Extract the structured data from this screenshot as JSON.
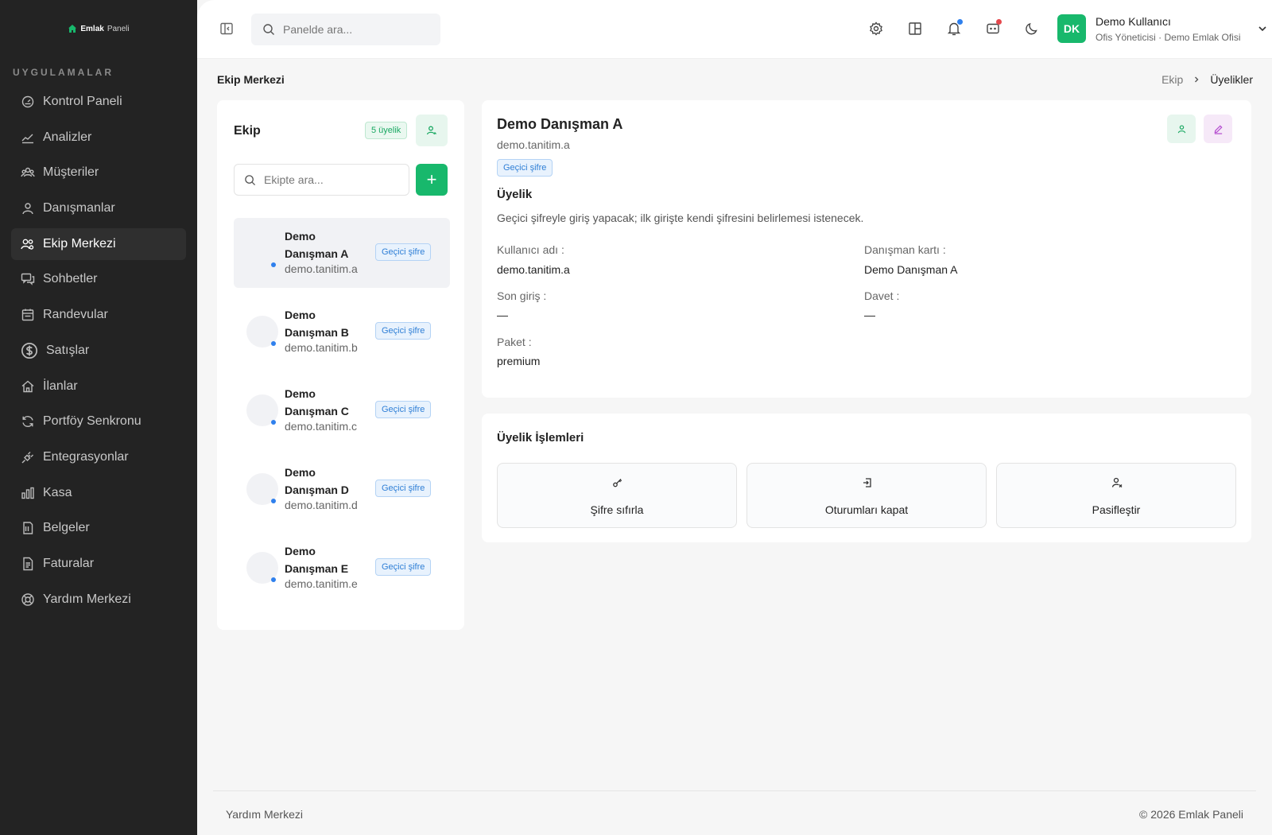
{
  "brand": {
    "bold": "Emlak",
    "light": "Paneli"
  },
  "sidebar": {
    "section_title": "UYGULAMALAR",
    "items": [
      {
        "label": "Kontrol Paneli",
        "icon": "dashboard-icon"
      },
      {
        "label": "Analizler",
        "icon": "chart-line-icon"
      },
      {
        "label": "Müşteriler",
        "icon": "customers-icon"
      },
      {
        "label": "Danışmanlar",
        "icon": "user-icon"
      },
      {
        "label": "Ekip Merkezi",
        "icon": "team-icon",
        "active": true
      },
      {
        "label": "Sohbetler",
        "icon": "chat-icon"
      },
      {
        "label": "Randevular",
        "icon": "calendar-icon"
      },
      {
        "label": "Satışlar",
        "icon": "dollar-icon"
      },
      {
        "label": "İlanlar",
        "icon": "home-icon"
      },
      {
        "label": "Portföy Senkronu",
        "icon": "sync-icon"
      },
      {
        "label": "Entegrasyonlar",
        "icon": "plug-icon"
      },
      {
        "label": "Kasa",
        "icon": "bar-chart-icon"
      },
      {
        "label": "Belgeler",
        "icon": "document-icon"
      },
      {
        "label": "Faturalar",
        "icon": "invoice-icon"
      },
      {
        "label": "Yardım Merkezi",
        "icon": "lifebuoy-icon"
      }
    ]
  },
  "topbar": {
    "search_placeholder": "Panelde ara...",
    "user": {
      "initials": "DK",
      "name": "Demo Kullanıcı",
      "role": "Ofis Yöneticisi · Demo Emlak Ofisi"
    },
    "colors": {
      "notification_dot": "#2f80ed",
      "message_dot": "#e5484d",
      "accent": "#18b86c"
    }
  },
  "page": {
    "title": "Ekip Merkezi",
    "breadcrumb": {
      "parent": "Ekip",
      "current": "Üyelikler"
    }
  },
  "team": {
    "title": "Ekip",
    "count_badge": "5 üyelik",
    "search_placeholder": "Ekipte ara...",
    "add_label": "+",
    "members": [
      {
        "first": "Demo",
        "last": "Danışman A",
        "username": "demo.tanitim.a",
        "badge": "Geçici şifre",
        "selected": true
      },
      {
        "first": "Demo",
        "last": "Danışman B",
        "username": "demo.tanitim.b",
        "badge": "Geçici şifre"
      },
      {
        "first": "Demo",
        "last": "Danışman C",
        "username": "demo.tanitim.c",
        "badge": "Geçici şifre"
      },
      {
        "first": "Demo",
        "last": "Danışman D",
        "username": "demo.tanitim.d",
        "badge": "Geçici şifre"
      },
      {
        "first": "Demo",
        "last": "Danışman E",
        "username": "demo.tanitim.e",
        "badge": "Geçici şifre"
      }
    ]
  },
  "detail": {
    "name": "Demo Danışman A",
    "username": "demo.tanitim.a",
    "badge": "Geçici şifre",
    "section": "Üyelik",
    "description": "Geçici şifreyle giriş yapacak; ilk girişte kendi şifresini belirlemesi istenecek.",
    "fields": {
      "username_label": "Kullanıcı adı :",
      "username_value": "demo.tanitim.a",
      "card_label": "Danışman kartı :",
      "card_value": "Demo Danışman A",
      "last_login_label": "Son giriş :",
      "last_login_value": "—",
      "invite_label": "Davet :",
      "invite_value": "—",
      "package_label": "Paket :",
      "package_value": "premium"
    }
  },
  "operations": {
    "title": "Üyelik İşlemleri",
    "buttons": [
      {
        "label": "Şifre sıfırla",
        "icon": "key-icon"
      },
      {
        "label": "Oturumları kapat",
        "icon": "logout-icon"
      },
      {
        "label": "Pasifleştir",
        "icon": "user-x-icon"
      }
    ]
  },
  "footer": {
    "left": "Yardım Merkezi",
    "right": "© 2026 Emlak Paneli"
  }
}
